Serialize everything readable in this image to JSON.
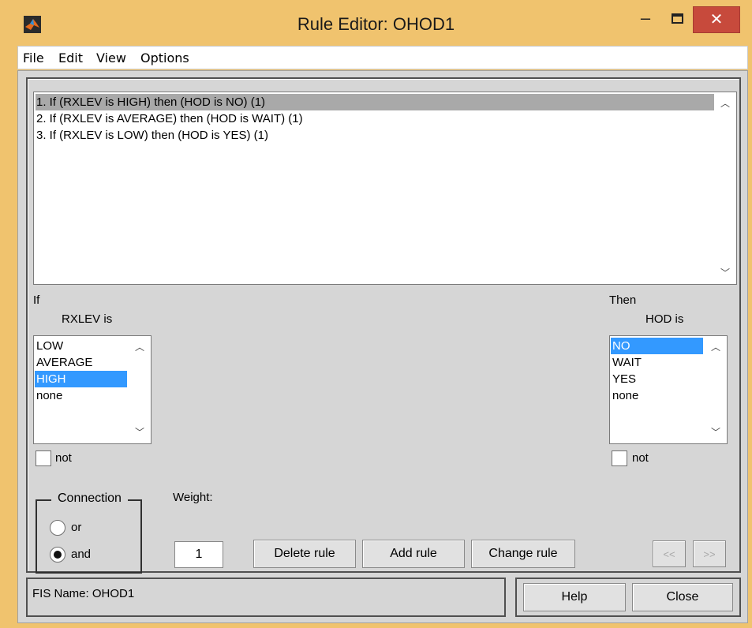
{
  "window": {
    "title": "Rule Editor: OHOD1",
    "minimize": "–",
    "close": "✕"
  },
  "menu": [
    "File",
    "Edit",
    "View",
    "Options"
  ],
  "rules": [
    "1. If (RXLEV is HIGH) then (HOD is NO) (1)",
    "2. If (RXLEV is AVERAGE) then (HOD is WAIT) (1)",
    "3. If (RXLEV is LOW) then (HOD is YES) (1)"
  ],
  "if_panel": {
    "label": "If",
    "var_label": "RXLEV is",
    "options": [
      "LOW",
      "AVERAGE",
      "HIGH",
      "none"
    ],
    "selected": "HIGH",
    "not_label": "not"
  },
  "then_panel": {
    "label": "Then",
    "var_label": "HOD is",
    "options": [
      "NO",
      "WAIT",
      "YES",
      "none"
    ],
    "selected": "NO",
    "not_label": "not"
  },
  "connection": {
    "label": "Connection",
    "or_label": "or",
    "and_label": "and",
    "selected": "and"
  },
  "weight": {
    "label": "Weight:",
    "value": "1"
  },
  "buttons": {
    "delete": "Delete rule",
    "add": "Add rule",
    "change": "Change rule",
    "prev": "<<",
    "next": ">>",
    "help": "Help",
    "close": "Close"
  },
  "status": "FIS Name: OHOD1",
  "colors": {
    "title_bar": "#f0c36e",
    "panel": "#d6d6d6",
    "selection": "#3399ff",
    "rule_selection": "#a9a9a9"
  }
}
